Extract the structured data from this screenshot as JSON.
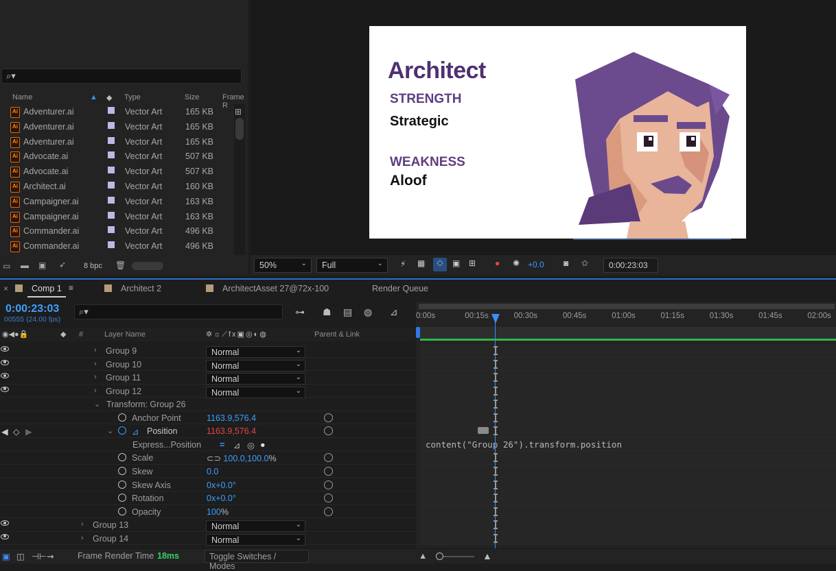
{
  "project": {
    "columns": {
      "name": "Name",
      "type": "Type",
      "size": "Size",
      "frame": "Frame R"
    },
    "files": [
      {
        "name": "Adventurer.ai",
        "type": "Vector Art",
        "size": "165 KB"
      },
      {
        "name": "Adventurer.ai",
        "type": "Vector Art",
        "size": "165 KB"
      },
      {
        "name": "Adventurer.ai",
        "type": "Vector Art",
        "size": "165 KB"
      },
      {
        "name": "Advocate.ai",
        "type": "Vector Art",
        "size": "507 KB"
      },
      {
        "name": "Advocate.ai",
        "type": "Vector Art",
        "size": "507 KB"
      },
      {
        "name": "Architect.ai",
        "type": "Vector Art",
        "size": "160 KB"
      },
      {
        "name": "Campaigner.ai",
        "type": "Vector Art",
        "size": "163 KB"
      },
      {
        "name": "Campaigner.ai",
        "type": "Vector Art",
        "size": "163 KB"
      },
      {
        "name": "Commander.ai",
        "type": "Vector Art",
        "size": "496 KB"
      },
      {
        "name": "Commander.ai",
        "type": "Vector Art",
        "size": "496 KB"
      }
    ],
    "bpc": "8 bpc"
  },
  "viewer": {
    "card": {
      "title": "Architect",
      "strength_label": "STRENGTH",
      "strength_value": "Strategic",
      "weakness_label": "WEAKNESS",
      "weakness_value": "Aloof",
      "accent_color": "#5b3a7d"
    },
    "zoom": "50%",
    "resolution": "Full",
    "exposure": "+0.0",
    "timecode": "0:00:23:03"
  },
  "tabs": [
    {
      "label": "Comp 1",
      "active": true
    },
    {
      "label": "Architect 2"
    },
    {
      "label": "ArchitectAsset 27@72x-100"
    },
    {
      "label": "Render Queue"
    }
  ],
  "timeline": {
    "current_time": "0:00:23:03",
    "frame_info": "00555 (24.00 fps)",
    "col_layer_name": "Layer Name",
    "col_parent": "Parent & Link",
    "col_number": "#",
    "ruler": [
      "0:00s",
      "00:15s",
      "00:30s",
      "00:45s",
      "01:00s",
      "01:15s",
      "01:30s",
      "01:45s",
      "02:00s"
    ],
    "playhead_seconds": 23.1,
    "rows": {
      "g9": {
        "name": "Group 9",
        "mode": "Normal"
      },
      "g10": {
        "name": "Group 10",
        "mode": "Normal"
      },
      "g11": {
        "name": "Group 11",
        "mode": "Normal"
      },
      "g12": {
        "name": "Group 12",
        "mode": "Normal"
      },
      "transform": {
        "name": "Transform: Group 26"
      },
      "anchor": {
        "name": "Anchor Point",
        "value": "1163.9,576.4"
      },
      "position": {
        "name": "Position",
        "value_a": "1163.9",
        "sep": ",",
        "value_b": "576.4"
      },
      "expr": {
        "name": "Express...Position",
        "text": "content(\"Group 26\").transform.position"
      },
      "scale": {
        "name": "Scale",
        "value": "100.0,100.0",
        "unit": "%"
      },
      "skew": {
        "name": "Skew",
        "value": "0.0"
      },
      "skewaxis": {
        "name": "Skew Axis",
        "prefix": "0x",
        "value": "+0.0°"
      },
      "rotation": {
        "name": "Rotation",
        "prefix": "0x",
        "value": "+0.0°"
      },
      "opacity": {
        "name": "Opacity",
        "value": "100",
        "unit": "%"
      },
      "g13": {
        "name": "Group 13",
        "mode": "Normal"
      },
      "g14": {
        "name": "Group 14",
        "mode": "Normal"
      }
    }
  },
  "status": {
    "render_label": "Frame Render Time",
    "render_value": "18ms",
    "toggle": "Toggle Switches / Modes"
  }
}
